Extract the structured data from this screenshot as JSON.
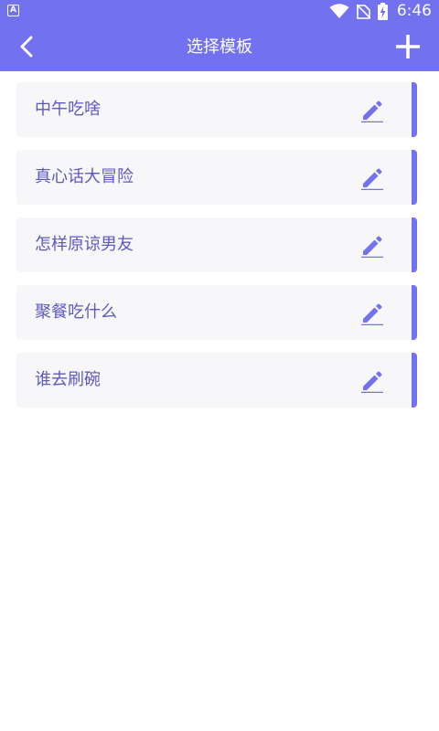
{
  "status_bar": {
    "left_icon_letter": "A",
    "time": "6:46",
    "icons": [
      "app-notification-icon",
      "wifi-icon",
      "no-sim-icon",
      "battery-charging-icon"
    ]
  },
  "header": {
    "title": "选择模板",
    "back_icon": "chevron-left-icon",
    "add_icon": "plus-icon"
  },
  "templates": [
    {
      "label": "中午吃啥",
      "edit_icon": "pencil-icon"
    },
    {
      "label": "真心话大冒险",
      "edit_icon": "pencil-icon"
    },
    {
      "label": "怎样原谅男友",
      "edit_icon": "pencil-icon"
    },
    {
      "label": "聚餐吃什么",
      "edit_icon": "pencil-icon"
    },
    {
      "label": "谁去刷碗",
      "edit_icon": "pencil-icon"
    }
  ],
  "colors": {
    "primary": "#7271EF",
    "item_background": "#F7F7FA",
    "item_text": "#5D5ABF"
  }
}
